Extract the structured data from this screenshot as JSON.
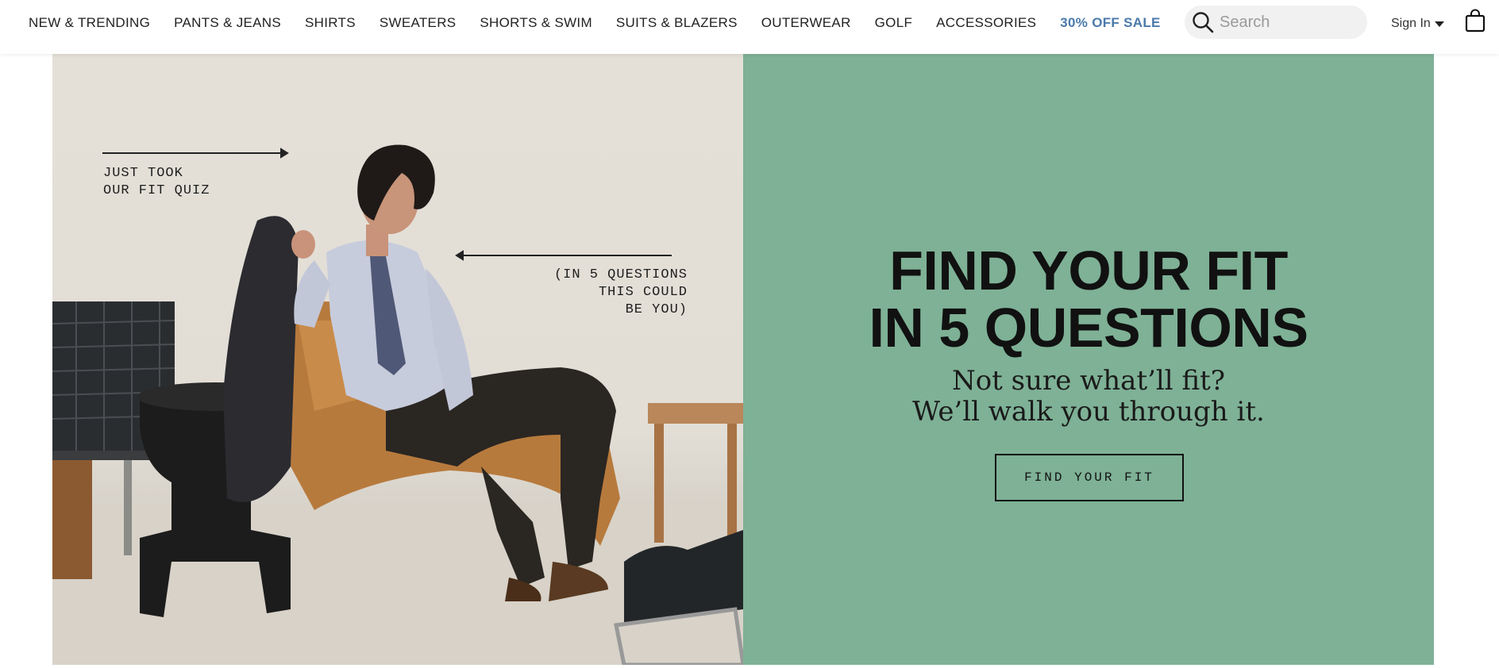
{
  "nav": {
    "items": [
      {
        "label": "NEW & TRENDING"
      },
      {
        "label": "PANTS & JEANS"
      },
      {
        "label": "SHIRTS"
      },
      {
        "label": "SWEATERS"
      },
      {
        "label": "SHORTS & SWIM"
      },
      {
        "label": "SUITS & BLAZERS"
      },
      {
        "label": "OUTERWEAR"
      },
      {
        "label": "GOLF"
      },
      {
        "label": "ACCESSORIES"
      },
      {
        "label": "30% OFF SALE"
      }
    ],
    "sale_color": "#4a7aab"
  },
  "search": {
    "placeholder": "Search",
    "icon": "search-icon"
  },
  "account": {
    "signin_label": "Sign In",
    "caret_icon": "caret-down-icon",
    "bag_icon": "shopping-bag-icon"
  },
  "hero": {
    "annotation_1": "JUST TOOK\nOUR FIT QUIZ",
    "annotation_2": "(IN 5 QUESTIONS\nTHIS COULD\nBE YOU)",
    "headline": "FIND YOUR FIT\nIN 5 QUESTIONS",
    "subheadline": "Not sure what’ll fit?\nWe’ll walk you through it.",
    "cta_label": "FIND YOUR FIT",
    "panel_color": "#7eb196"
  }
}
